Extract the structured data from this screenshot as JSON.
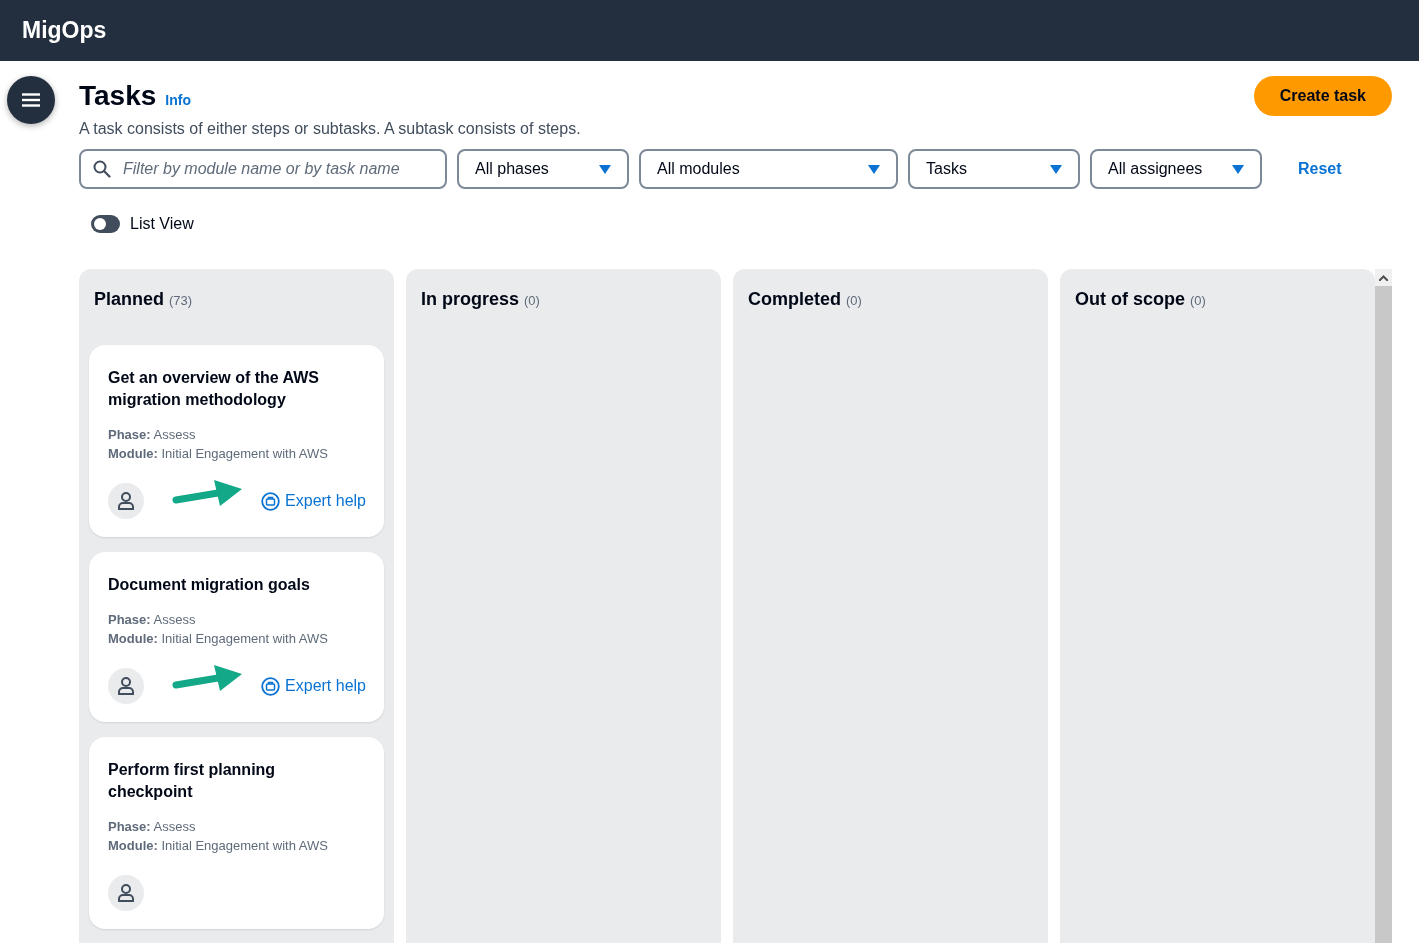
{
  "header": {
    "brand": "MigOps"
  },
  "page": {
    "title": "Tasks",
    "info_link": "Info",
    "description": "A task consists of either steps or subtasks. A subtask consists of steps.",
    "create_button": "Create task"
  },
  "filters": {
    "search": {
      "placeholder": "Filter by module name or by task name"
    },
    "dropdowns": [
      {
        "value": "All phases"
      },
      {
        "value": "All modules"
      },
      {
        "value": "Tasks"
      },
      {
        "value": "All assignees"
      }
    ],
    "reset": "Reset"
  },
  "list_view": {
    "label": "List View",
    "on": false
  },
  "board": {
    "columns": [
      {
        "title": "Planned",
        "count": "(73)",
        "cards": [
          {
            "title": "Get an overview of the AWS migration methodology",
            "phase_label": "Phase:",
            "phase": "Assess",
            "module_label": "Module:",
            "module": "Initial Engagement with AWS",
            "expert_help": "Expert help",
            "annotation_arrow": true
          },
          {
            "title": "Document migration goals",
            "phase_label": "Phase:",
            "phase": "Assess",
            "module_label": "Module:",
            "module": "Initial Engagement with AWS",
            "expert_help": "Expert help",
            "annotation_arrow": true
          },
          {
            "title": "Perform first planning checkpoint",
            "phase_label": "Phase:",
            "phase": "Assess",
            "module_label": "Module:",
            "module": "Initial Engagement with AWS",
            "annotation_arrow": false
          }
        ]
      },
      {
        "title": "In progress",
        "count": "(0)"
      },
      {
        "title": "Completed",
        "count": "(0)"
      },
      {
        "title": "Out of scope",
        "count": "(0)"
      }
    ]
  }
}
